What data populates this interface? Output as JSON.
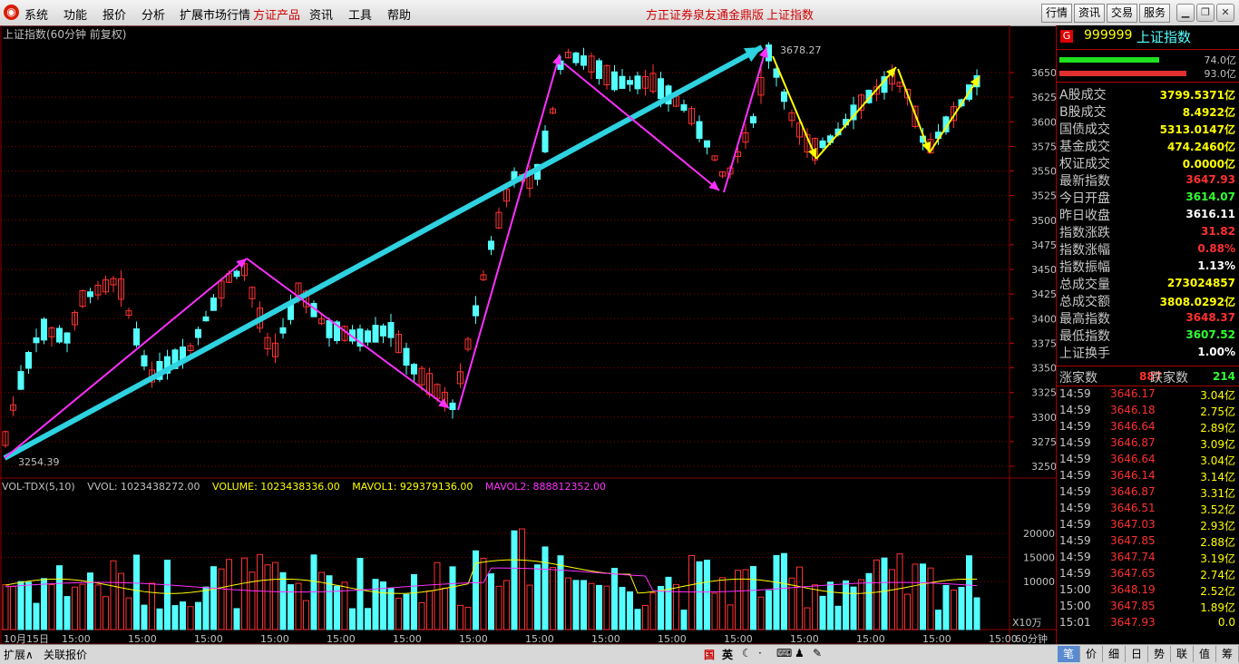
{
  "menu": {
    "items": [
      "系统",
      "功能",
      "报价",
      "分析",
      "扩展市场行情",
      "方证产品",
      "资讯",
      "工具",
      "帮助"
    ],
    "center_title": "方正证券泉友通金鼎版",
    "center_sub": "上证指数",
    "right_buttons": [
      "行情",
      "资讯",
      "交易",
      "服务"
    ]
  },
  "chart": {
    "title": "上证指数(60分钟 前复权)",
    "high_label": "3678.27",
    "low_label": "3254.39",
    "price_axis": [
      "3650",
      "3625",
      "3600",
      "3575",
      "3550",
      "3525",
      "3500",
      "3475",
      "3450",
      "3425",
      "3400",
      "3375",
      "3350",
      "3325",
      "3300",
      "3275",
      "3250"
    ],
    "vol_axis": [
      "20000",
      "15000",
      "10000"
    ],
    "vol_unit": "X10万",
    "time_axis": [
      "10月15日",
      "15:00",
      "15:00",
      "15:00",
      "15:00",
      "15:00",
      "15:00",
      "15:00",
      "15:00",
      "15:00",
      "15:00",
      "15:00",
      "15:00",
      "15:00",
      "15:00",
      "15:00"
    ],
    "period": "60分钟",
    "colors": {
      "up": "#ff3232",
      "down": "#54ffff",
      "arrow_cyan": "#2ed2e0",
      "arrow_magenta": "#ff30ff",
      "arrow_yellow": "#ffff00",
      "grid": "#8b0000"
    }
  },
  "volume_legend": {
    "name": "VOL-TDX(5,10)",
    "vvol": "VVOL: 1023438272.00",
    "volume": "VOLUME: 1023438336.00",
    "mavol1": "MAVOL1: 929379136.00",
    "mavol2": "MAVOL2: 888812352.00"
  },
  "panel": {
    "code": "999999",
    "name": "上证指数",
    "buy_vol": "74.0亿",
    "sell_vol": "93.0亿",
    "stats": [
      {
        "k": "A股成交",
        "v": "3799.5371亿",
        "c": "#ffff00"
      },
      {
        "k": "B股成交",
        "v": "8.4922亿",
        "c": "#ffff00"
      },
      {
        "k": "国债成交",
        "v": "5313.0147亿",
        "c": "#ffff00"
      },
      {
        "k": "基金成交",
        "v": "474.2460亿",
        "c": "#ffff00"
      },
      {
        "k": "权证成交",
        "v": "0.0000亿",
        "c": "#ffff00"
      },
      {
        "k": "最新指数",
        "v": "3647.93",
        "c": "#ff3030"
      },
      {
        "k": "今日开盘",
        "v": "3614.07",
        "c": "#30ff30"
      },
      {
        "k": "昨日收盘",
        "v": "3616.11",
        "c": "#ffffff"
      },
      {
        "k": "指数涨跌",
        "v": "31.82",
        "c": "#ff3030"
      },
      {
        "k": "指数涨幅",
        "v": "0.88%",
        "c": "#ff3030"
      },
      {
        "k": "指数振幅",
        "v": "1.13%",
        "c": "#ffffff"
      },
      {
        "k": "总成交量",
        "v": "273024857",
        "c": "#ffff00"
      },
      {
        "k": "总成交额",
        "v": "3808.0292亿",
        "c": "#ffff00"
      },
      {
        "k": "最高指数",
        "v": "3648.37",
        "c": "#ff3030"
      },
      {
        "k": "最低指数",
        "v": "3607.52",
        "c": "#30ff30"
      },
      {
        "k": "上证换手",
        "v": "1.00%",
        "c": "#ffffff"
      }
    ],
    "up_label": "涨家数",
    "up_count": "887",
    "down_label": "跌家数",
    "down_count": "214",
    "ticks": [
      {
        "t": "14:59",
        "p": "3646.17",
        "q": "3.04亿"
      },
      {
        "t": "14:59",
        "p": "3646.18",
        "q": "2.75亿"
      },
      {
        "t": "14:59",
        "p": "3646.64",
        "q": "2.89亿"
      },
      {
        "t": "14:59",
        "p": "3646.87",
        "q": "3.09亿"
      },
      {
        "t": "14:59",
        "p": "3646.64",
        "q": "3.04亿"
      },
      {
        "t": "14:59",
        "p": "3646.14",
        "q": "3.14亿"
      },
      {
        "t": "14:59",
        "p": "3646.87",
        "q": "3.31亿"
      },
      {
        "t": "14:59",
        "p": "3646.51",
        "q": "3.52亿"
      },
      {
        "t": "14:59",
        "p": "3647.03",
        "q": "2.93亿"
      },
      {
        "t": "14:59",
        "p": "3647.85",
        "q": "2.88亿"
      },
      {
        "t": "14:59",
        "p": "3647.74",
        "q": "3.19亿"
      },
      {
        "t": "14:59",
        "p": "3647.65",
        "q": "2.74亿"
      },
      {
        "t": "15:00",
        "p": "3648.19",
        "q": "2.52亿"
      },
      {
        "t": "15:00",
        "p": "3647.85",
        "q": "1.89亿"
      },
      {
        "t": "15:01",
        "p": "3647.93",
        "q": "0.0"
      }
    ]
  },
  "statusbar": {
    "expand": "扩展∧",
    "related": "关联报价",
    "ime": [
      "国",
      "英"
    ],
    "tabs": [
      "笔",
      "价",
      "细",
      "日",
      "势",
      "联",
      "值",
      "筹"
    ]
  }
}
